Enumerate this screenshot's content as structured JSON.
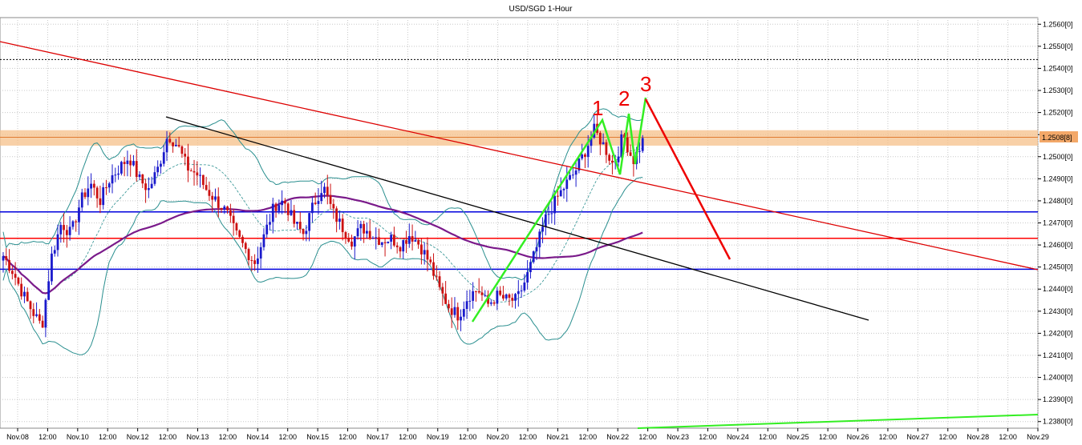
{
  "chart_data": {
    "type": "candlestick",
    "title": "USD/SGD 1-Hour",
    "y_ticks": [
      "1.2560[0]",
      "1.2550[0]",
      "1.2540[0]",
      "1.2530[0]",
      "1.2520[0]",
      "1.2510[0]",
      "1.2500[0]",
      "1.2490[0]",
      "1.2480[0]",
      "1.2470[0]",
      "1.2460[0]",
      "1.2450[0]",
      "1.2440[0]",
      "1.2430[0]",
      "1.2420[0]",
      "1.2410[0]",
      "1.2400[0]",
      "1.2390[0]",
      "1.2380[0]"
    ],
    "ylim": [
      1.2377,
      1.2563
    ],
    "x_ticks": [
      "Nov.08",
      "12:00",
      "Nov.10",
      "12:00",
      "Nov.12",
      "12:00",
      "Nov.13",
      "12:00",
      "Nov.14",
      "12:00",
      "Nov.15",
      "12:00",
      "Nov.17",
      "12:00",
      "Nov.19",
      "12:00",
      "Nov.20",
      "12:00",
      "Nov.21",
      "12:00",
      "Nov.22",
      "12:00",
      "Nov.23",
      "12:00",
      "Nov.24",
      "12:00",
      "Nov.25",
      "12:00",
      "Nov.26",
      "12:00",
      "Nov.27",
      "12:00",
      "Nov.28",
      "12:00",
      "Nov.29"
    ],
    "current_price_label": "1.2508[8]",
    "current_price": 1.25088,
    "resistance_zone": [
      1.2505,
      1.2512
    ],
    "horizontal_levels": [
      {
        "price": 1.2475,
        "color": "#0000dd"
      },
      {
        "price": 1.2463,
        "color": "#ff0000"
      },
      {
        "price": 1.2449,
        "color": "#0000dd"
      }
    ],
    "dotted_level": 1.2544,
    "wave_labels": [
      "1",
      "2",
      "3"
    ],
    "grid": true,
    "price_series": [
      1.2455,
      1.2448,
      1.2438,
      1.243,
      1.2423,
      1.2455,
      1.247,
      1.2465,
      1.248,
      1.2488,
      1.248,
      1.249,
      1.2495,
      1.25,
      1.249,
      1.2485,
      1.2495,
      1.251,
      1.2505,
      1.2495,
      1.2492,
      1.2485,
      1.248,
      1.2475,
      1.2465,
      1.2458,
      1.2452,
      1.2465,
      1.2478,
      1.248,
      1.247,
      1.2465,
      1.2478,
      1.2487,
      1.2475,
      1.2468,
      1.2462,
      1.2468,
      1.2465,
      1.2462,
      1.2463,
      1.246,
      1.2465,
      1.246,
      1.2452,
      1.244,
      1.2432,
      1.2428,
      1.2437,
      1.244,
      1.2433,
      1.2437,
      1.2435,
      1.2435,
      1.2445,
      1.2458,
      1.2472,
      1.248,
      1.2487,
      1.2493,
      1.2502,
      1.2512,
      1.2505,
      1.2496,
      1.251,
      1.2498,
      1.2507
    ],
    "colors": {
      "up": "#1a1acc",
      "down": "#cc1111",
      "bollinger": "#2a8f8f",
      "ma": "#7a1a8a",
      "trend_red": "#dd0000",
      "trend_black": "#000000",
      "wave_green": "#33ee22",
      "zone": "#f5c08a",
      "price_tag": "#f3a869"
    }
  }
}
